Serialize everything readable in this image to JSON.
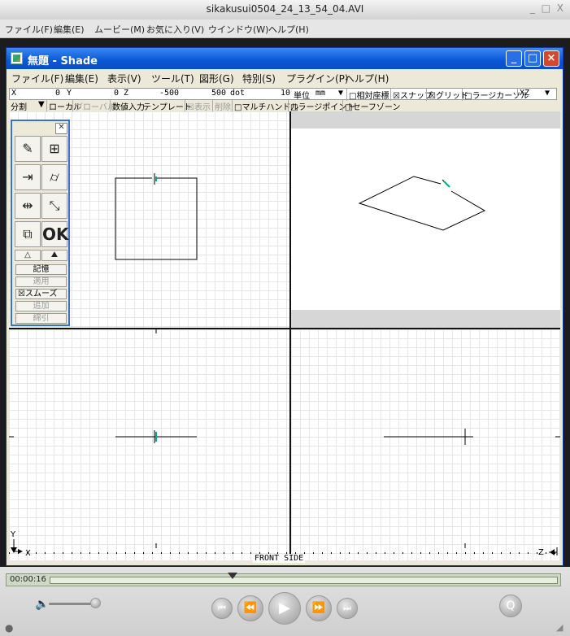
{
  "player": {
    "title": "sikakusui0504_24_13_54_04.AVI",
    "window_controls": "_ □ X",
    "menu": [
      "ファイル(F)",
      "編集(E)",
      "ムービー(M)",
      "お気に入り(V)",
      "ウインドウ(W)",
      "ヘルプ(H)"
    ],
    "time": "00:00:16",
    "progress_fraction": 0.36
  },
  "shade": {
    "title": "無題 - Shade",
    "menu": [
      "ファイル(F)",
      "編集(E)",
      "表示(V)",
      "ツール(T)",
      "図形(G)",
      "特別(S)",
      "プラグイン(P)",
      "ヘルプ(H)"
    ],
    "status1": {
      "x_label": "X",
      "x_val": "0",
      "y_label": "Y",
      "y_val": "0",
      "z_label": "Z",
      "z_val": "-500",
      "dot_val": "500",
      "dot_label": "dot",
      "dot_count": "10",
      "unit_label": "単位",
      "unit_val": "mm",
      "relative": "□相対座標",
      "snap": "☒スナップ",
      "grid": "☒グリッド",
      "large_cursor": "□ラージカーソル",
      "plane": "XZ"
    },
    "status2": {
      "split": "分割",
      "local": "ローカル",
      "global": "グローバル",
      "numeric": "数値入力",
      "template": "テンプレート",
      "display": "☒表示",
      "delete": "削除",
      "multi_handle": "□マルチハンドル",
      "large_point": "□ラージポイント",
      "safe_zone": "□セーフゾーン"
    },
    "viewport_label": "FRONT SIDE",
    "axis_y": "Y",
    "axis_x": "X",
    "axis_z": "Z"
  },
  "palette": {
    "ok_label": "OK",
    "memory": "記憶",
    "apply": "適用",
    "smooth": "☒スムーズ",
    "add": "追加",
    "subtract": "綿引"
  }
}
